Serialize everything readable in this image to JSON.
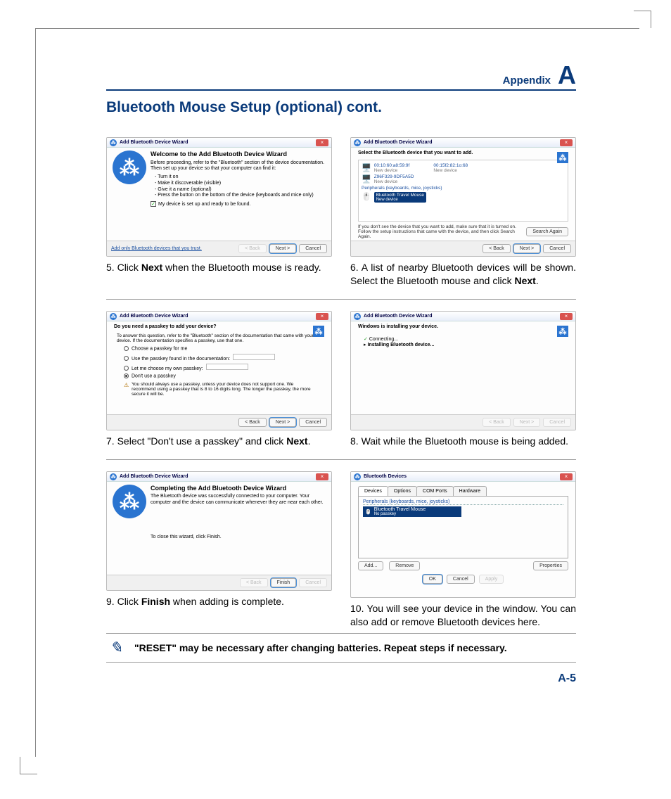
{
  "header": {
    "appendix_label": "Appendix",
    "appendix_letter": "A"
  },
  "title": "Bluetooth Mouse Setup (optional) cont.",
  "page_number": "A-5",
  "win_title": "Add Bluetooth Device Wizard",
  "close_x": "×",
  "btn_back": "< Back",
  "btn_next": "Next >",
  "btn_cancel": "Cancel",
  "btn_finish": "Finish",
  "btn_ok": "OK",
  "btn_apply": "Apply",
  "btn_search_again": "Search Again",
  "btn_add": "Add...",
  "btn_remove": "Remove",
  "btn_properties": "Properties",
  "shot5": {
    "heading": "Welcome to the Add Bluetooth Device Wizard",
    "intro": "Before proceeding, refer to the \"Bluetooth\" section of the device documentation. Then set up your device so that your computer can find it:",
    "b1": "- Turn it on",
    "b2": "- Make it discoverable (visible)",
    "b3": "- Give it a name (optional)",
    "b4": "- Press the button on the bottom of the device (keyboards and mice only)",
    "check": "My device is set up and ready to be found.",
    "link": "Add only Bluetooth devices that you trust."
  },
  "shot6": {
    "prompt": "Select the Bluetooth device that you want to add.",
    "dev1_addr": "00:10:60:a8:59:9f",
    "dev1_sub": "New device",
    "dev2_addr": "00:15f2:82:1o:68",
    "dev2_sub": "New device",
    "dev3_addr": "Z96F329-9DF5A5D",
    "dev3_sub": "New device",
    "group": "Peripherals (keyboards, mice, joysticks)",
    "sel_name": "Bluetooth Travel Mouse",
    "sel_sub": "New device",
    "hint": "If you don't see the device that you want to add, make sure that it is turned on. Follow the setup instructions that came with the device, and then click Search Again."
  },
  "shot7": {
    "prompt": "Do you need a passkey to add your device?",
    "hint": "To answer this question, refer to the \"Bluetooth\" section of the documentation that came with your device. If the documentation specifies a passkey, use that one.",
    "opt1": "Choose a passkey for me",
    "opt2": "Use the passkey found in the documentation:",
    "opt3": "Let me choose my own passkey:",
    "opt4": "Don't use a passkey",
    "warn": "You should always use a passkey, unless your device does not support one. We recommend using a passkey that is 8 to 16 digits long. The longer the passkey, the more secure it will be."
  },
  "shot8": {
    "prompt": "Windows is installing your device.",
    "line1": "Connecting...",
    "line2": "Installing Bluetooth device..."
  },
  "shot9": {
    "heading": "Completing the Add Bluetooth Device Wizard",
    "text": "The Bluetooth device was successfully connected to your computer. Your computer and the device can communicate whenever they are near each other.",
    "close": "To close this wizard, click Finish."
  },
  "shot10": {
    "title": "Bluetooth Devices",
    "tab1": "Devices",
    "tab2": "Options",
    "tab3": "COM Ports",
    "tab4": "Hardware",
    "group": "Peripherals (keyboards, mice, joysticks)",
    "dev": "Bluetooth Travel Mouse",
    "sub": "No passkey"
  },
  "cap5": {
    "num": "5.",
    "pre": "Click ",
    "bold": "Next",
    "post": " when the Bluetooth mouse is ready."
  },
  "cap6": {
    "num": "6.",
    "pre": "A list of nearby Bluetooth devices will be shown. Select the Bluetooth mouse and click ",
    "bold": "Next",
    "post": "."
  },
  "cap7": {
    "num": "7.",
    "pre": "Select \"Don't use a passkey\" and click ",
    "bold": "Next",
    "post": "."
  },
  "cap8": {
    "num": "8.",
    "text": "Wait while the Bluetooth mouse is being added."
  },
  "cap9": {
    "num": "9.",
    "pre": "Click ",
    "bold": "Finish",
    "post": " when adding is complete."
  },
  "cap10": {
    "num": "10.",
    "text": "You will see your device in the window. You can also add or remove Bluetooth devices here."
  },
  "note": "\"RESET\" may be necessary after changing batteries. Repeat steps if necessary."
}
